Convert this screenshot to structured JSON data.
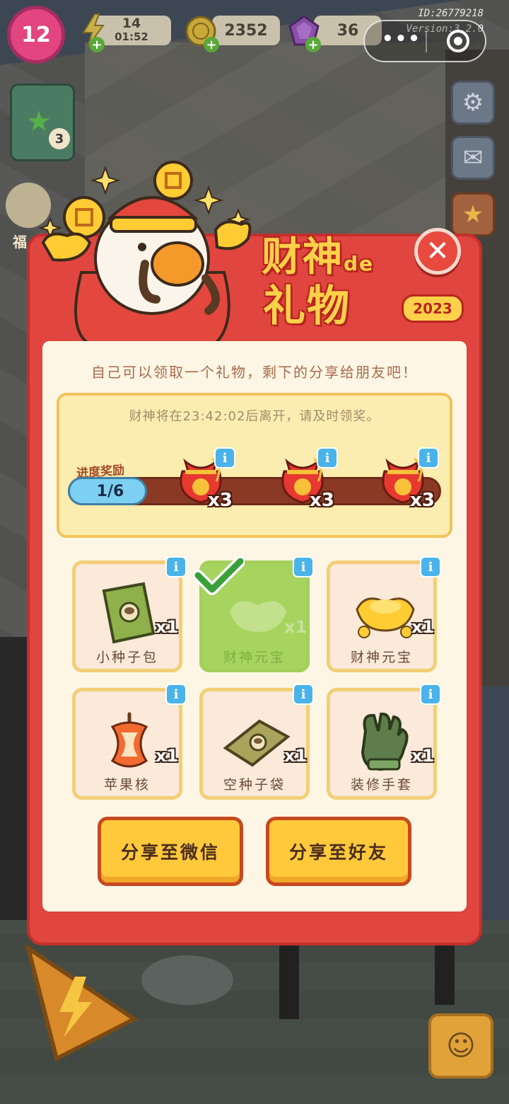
{
  "hud": {
    "level": "12",
    "energy_value": "14",
    "energy_timer": "01:52",
    "coins": "2352",
    "gems": "36",
    "id_text": "ID:26779218",
    "version_text": "Version:3.2.0",
    "task_badge_count": "3",
    "left_banner_text": "福",
    "more_icon": "more-dots-icon",
    "target_icon": "target-icon"
  },
  "dialog": {
    "title_line1": "财神",
    "title_de": "de",
    "title_line2": "礼物",
    "year": "2023",
    "intro": "自己可以领取一个礼物，剩下的分享给朋友吧！",
    "timer_text": "财神将在23:42:02后离开，请及时领奖。",
    "progress": {
      "label": "进度奖励",
      "value_text": "1/6",
      "fraction": 0.1667,
      "rewards": [
        {
          "count": "x3"
        },
        {
          "count": "x3"
        },
        {
          "count": "x3"
        }
      ]
    },
    "gifts": [
      {
        "name": "小种子包",
        "count": "x1",
        "claimed": false
      },
      {
        "name": "财神元宝",
        "count": "x1",
        "claimed": true
      },
      {
        "name": "财神元宝",
        "count": "x1",
        "claimed": false
      },
      {
        "name": "苹果核",
        "count": "x1",
        "claimed": false
      },
      {
        "name": "空种子袋",
        "count": "x1",
        "claimed": false
      },
      {
        "name": "装修手套",
        "count": "x1",
        "claimed": false
      }
    ],
    "info_glyph": "i",
    "close_glyph": "✕",
    "share_wechat": "分享至微信",
    "share_friend": "分享至好友"
  },
  "colors": {
    "dialog_red": "#e1453f",
    "paper": "#fdf6e5",
    "button_yellow": "#ffc93b",
    "claimed_green": "#a7d45f",
    "info_blue": "#4ab3ea"
  }
}
